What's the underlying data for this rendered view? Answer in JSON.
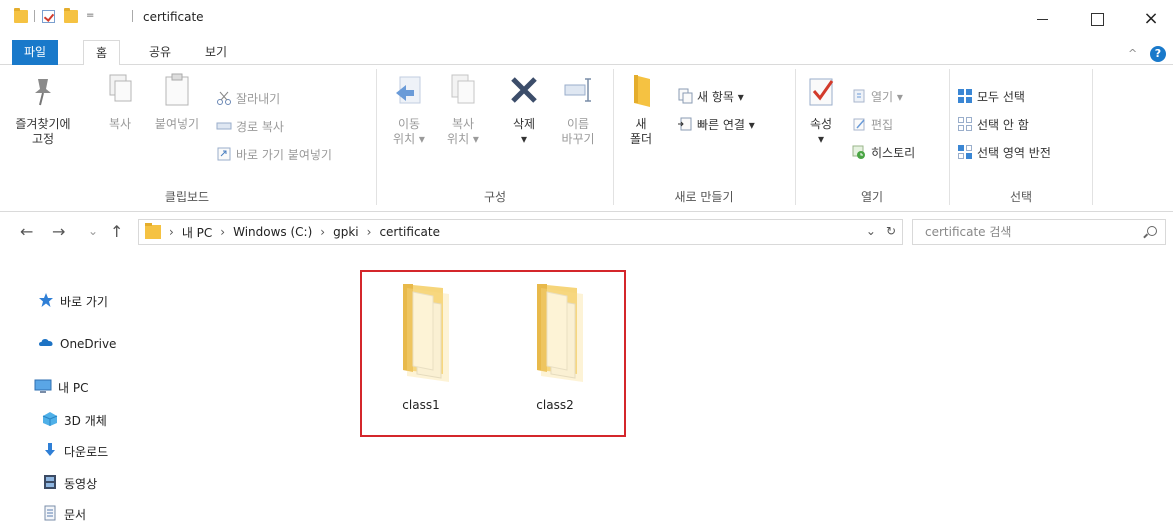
{
  "window": {
    "title": "certificate",
    "qa_dropdown": "="
  },
  "tabs": {
    "file": "파일",
    "home": "홈",
    "share": "공유",
    "view": "보기"
  },
  "ribbon": {
    "clipboard": {
      "label": "클립보드",
      "pin": "즐겨찾기에\n고정",
      "copy": "복사",
      "paste": "붙여넣기",
      "cut": "잘라내기",
      "copy_path": "경로 복사",
      "paste_shortcut": "바로 가기 붙여넣기"
    },
    "organize": {
      "label": "구성",
      "move_to": "이동\n위치 ▾",
      "copy_to": "복사\n위치 ▾",
      "delete": "삭제\n▾",
      "rename": "이름\n바꾸기"
    },
    "new": {
      "label": "새로 만들기",
      "new_folder": "새\n폴더",
      "new_item": "새 항목 ▾",
      "easy_access": "빠른 연결 ▾"
    },
    "open": {
      "label": "열기",
      "properties": "속성\n▾",
      "open": "열기 ▾",
      "edit": "편집",
      "history": "히스토리"
    },
    "select": {
      "label": "선택",
      "select_all": "모두 선택",
      "select_none": "선택 안 함",
      "invert": "선택 영역 반전"
    }
  },
  "nav": {
    "back": "←",
    "forward": "→",
    "recent": "⌄",
    "up": "↑",
    "breadcrumb": [
      "내 PC",
      "Windows (C:)",
      "gpki",
      "certificate"
    ],
    "breadcrumb_sep": "›",
    "dropdown": "⌄",
    "refresh": "↻",
    "search_placeholder": "certificate 검색"
  },
  "navpane": {
    "items": [
      "바로 가기",
      "OneDrive",
      "내 PC",
      "3D 개체",
      "다운로드",
      "동영상",
      "문서"
    ]
  },
  "files": [
    {
      "name": "class1"
    },
    {
      "name": "class2"
    }
  ],
  "colors": {
    "accent": "#1979ca",
    "folder": "#f5c242",
    "highlight": "#d4262b"
  }
}
